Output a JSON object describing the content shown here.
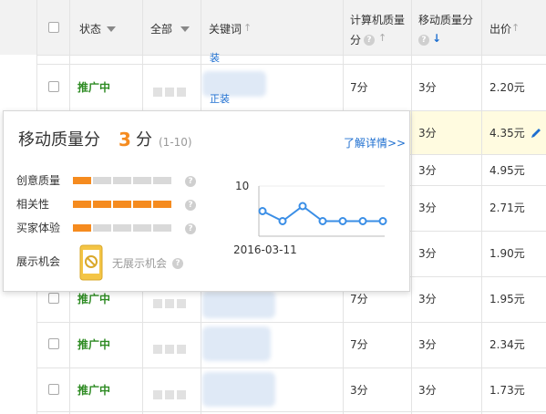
{
  "header": {
    "status_label": "状态",
    "all_label": "全部",
    "keyword_label": "关键词",
    "pc_quality_label_1": "计算机质量",
    "pc_quality_label_2": "分",
    "mobile_quality_label": "移动质量分",
    "bid_label": "出价"
  },
  "rows": [
    {
      "status": "",
      "keyword_fragment": "装",
      "pc_score": "",
      "mobile_score": "",
      "bid": ""
    },
    {
      "status": "推广中",
      "keyword_fragment": "正装",
      "pc_score": "7分",
      "mobile_score": "3分",
      "bid": "2.20元"
    },
    {
      "status": "",
      "keyword_fragment": "",
      "pc_score": "",
      "mobile_score": "3分",
      "bid": "4.35元"
    },
    {
      "status": "",
      "keyword_fragment": "",
      "pc_score": "",
      "mobile_score": "3分",
      "bid": "4.95元"
    },
    {
      "status": "",
      "keyword_fragment": "",
      "pc_score": "",
      "mobile_score": "3分",
      "bid": "2.71元"
    },
    {
      "status": "",
      "keyword_fragment": "",
      "pc_score": "",
      "mobile_score": "3分",
      "bid": "1.90元"
    },
    {
      "status": "推广中",
      "keyword_fragment": "",
      "pc_score": "7分",
      "mobile_score": "3分",
      "bid": "1.95元"
    },
    {
      "status": "推广中",
      "keyword_fragment": "",
      "pc_score": "7分",
      "mobile_score": "3分",
      "bid": "2.34元"
    },
    {
      "status": "推广中",
      "keyword_fragment": "",
      "pc_score": "3分",
      "mobile_score": "3分",
      "bid": "1.73元"
    }
  ],
  "popup": {
    "title": "移动质量分",
    "score": "3",
    "score_unit": "分",
    "range": "(1-10)",
    "more_link": "了解详情>>",
    "metrics": [
      {
        "label": "创意质量",
        "filled": 1,
        "total": 5
      },
      {
        "label": "相关性",
        "filled": 5,
        "total": 5
      },
      {
        "label": "买家体验",
        "filled": 1,
        "total": 5
      }
    ],
    "exposure_label": "展示机会",
    "exposure_value": "无展示机会",
    "chart_ymax_label": "10",
    "chart_date": "2016-03-11"
  },
  "chart_data": {
    "type": "line",
    "ylim": [
      0,
      10
    ],
    "y_tick_labels": [
      "10"
    ],
    "x_tick_labels": [
      "2016-03-11"
    ],
    "series": [
      {
        "values": [
          5,
          3,
          6,
          3,
          3,
          3,
          3
        ]
      }
    ]
  },
  "colors": {
    "accent_orange": "#f58b1f",
    "bar_grey": "#d9d9d9",
    "link_blue": "#1e6fd0",
    "status_green": "#2e8b23",
    "chart_line": "#3a8ee6",
    "highlight_row": "#fffbe0"
  }
}
